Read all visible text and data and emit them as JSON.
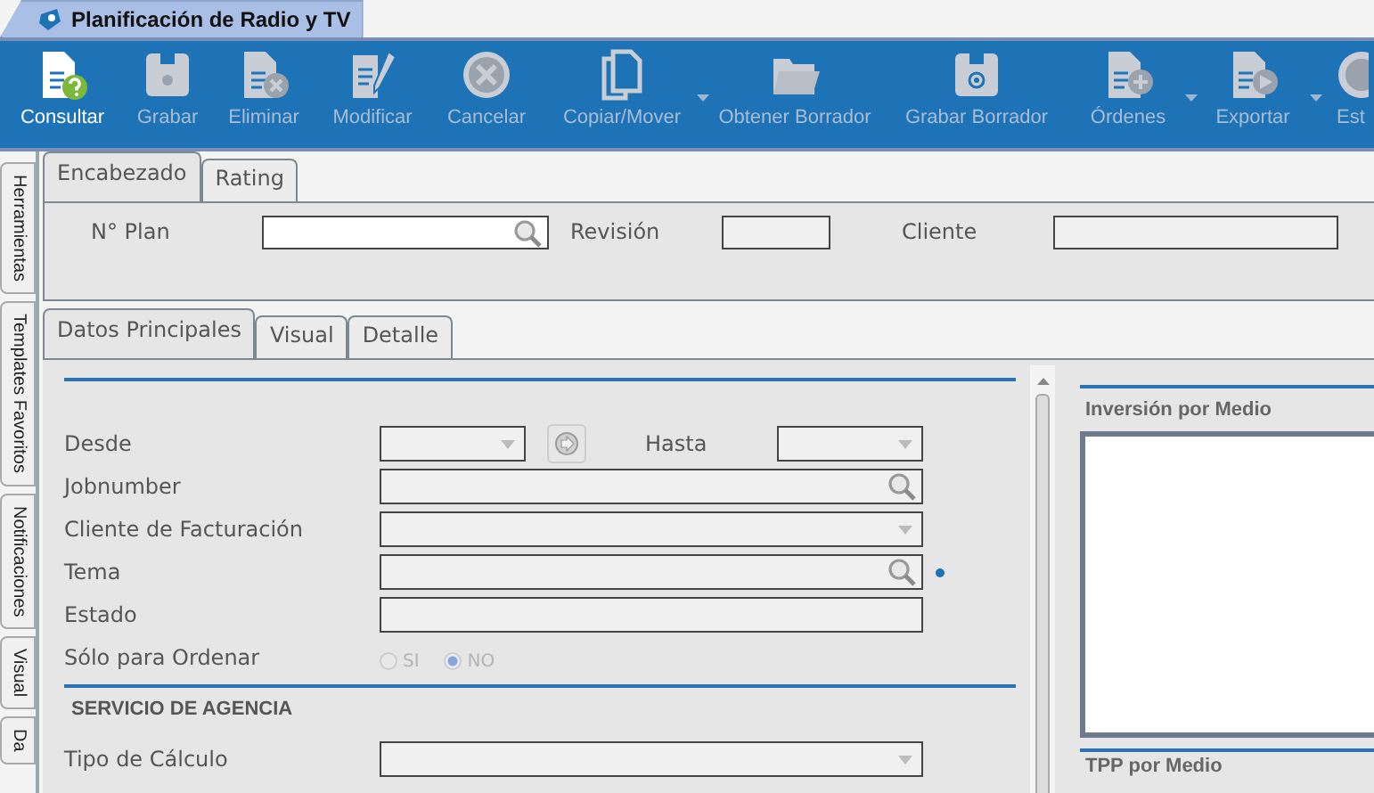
{
  "window": {
    "title": "Planificación de Radio y TV"
  },
  "toolbar": [
    {
      "label": "Consultar",
      "disabled": false,
      "menu": false
    },
    {
      "label": "Grabar",
      "disabled": true,
      "menu": false
    },
    {
      "label": "Eliminar",
      "disabled": true,
      "menu": false
    },
    {
      "label": "Modificar",
      "disabled": true,
      "menu": false
    },
    {
      "label": "Cancelar",
      "disabled": true,
      "menu": false
    },
    {
      "label": "Copiar/Mover",
      "disabled": true,
      "menu": true
    },
    {
      "label": "Obtener Borrador",
      "disabled": true,
      "menu": false
    },
    {
      "label": "Grabar Borrador",
      "disabled": true,
      "menu": false
    },
    {
      "label": "Órdenes",
      "disabled": true,
      "menu": true
    },
    {
      "label": "Exportar",
      "disabled": true,
      "menu": true
    },
    {
      "label": "Est",
      "disabled": true,
      "menu": false
    }
  ],
  "side_tabs": [
    "Herramientas",
    "Templates Favoritos",
    "Notificaciones",
    "Visual",
    "Da"
  ],
  "header": {
    "tabs": [
      {
        "label": "Encabezado",
        "selected": true
      },
      {
        "label": "Rating",
        "selected": false
      }
    ],
    "fields": [
      {
        "label": "N° Plan",
        "kind": "search",
        "disabled": false
      },
      {
        "label": "Revisión",
        "kind": "text",
        "disabled": true
      },
      {
        "label": "Cliente",
        "kind": "text",
        "disabled": true
      }
    ]
  },
  "detail_tabs": [
    {
      "label": "Datos Principales",
      "selected": true
    },
    {
      "label": "Visual",
      "selected": false
    },
    {
      "label": "Detalle",
      "selected": false
    }
  ],
  "form": {
    "date_range": {
      "from_label": "Desde",
      "to_label": "Hasta"
    },
    "rows": [
      {
        "label": "Jobnumber",
        "kind": "search",
        "required": false
      },
      {
        "label": "Cliente de Facturación",
        "kind": "dropdown",
        "required": false
      },
      {
        "label": "Tema",
        "kind": "search",
        "required": true
      },
      {
        "label": "Estado",
        "kind": "text",
        "required": false
      }
    ],
    "radio": {
      "label": "Sólo para Ordenar",
      "disabled": true,
      "options": [
        {
          "label": "SI",
          "selected": false
        },
        {
          "label": "NO",
          "selected": true
        }
      ]
    },
    "section_title": "SERVICIO DE AGENCIA",
    "section_rows": [
      {
        "label": "Tipo de Cálculo",
        "kind": "dropdown",
        "required": false
      }
    ]
  },
  "side_panels": [
    {
      "title": "Inversión por Medio"
    },
    {
      "title": "TPP por Medio"
    }
  ]
}
